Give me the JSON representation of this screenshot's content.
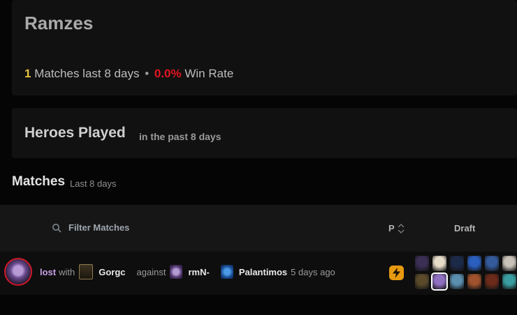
{
  "player": {
    "name": "Ramzes",
    "match_count": "1",
    "matches_label": "Matches last 8 days",
    "separator": "•",
    "winrate": "0.0%",
    "winrate_label": "Win Rate",
    "colors": {
      "count": "#e6c23a",
      "winrate": "#e3141f"
    }
  },
  "heroes_played": {
    "title": "Heroes Played",
    "subtitle": "in the past 8 days"
  },
  "matches": {
    "title": "Matches",
    "subtitle": "Last 8 days",
    "filter_placeholder": "Filter Matches",
    "columns": {
      "party": "P",
      "draft": "Draft"
    },
    "rows": [
      {
        "result": "lost",
        "with_word": "with",
        "ally": "Gorgc",
        "against_word": "against",
        "opponents": [
          "rmN-",
          "Palantimos"
        ],
        "time": "5 days ago",
        "party_icon": "lightning-icon",
        "hero_icon": "hero-portrait-icon",
        "draft": {
          "top": [
            "#3b2f55",
            "#e6dcc8",
            "#1c2a4a",
            "#2a5fbf",
            "#345a9c",
            "#c9c2b8"
          ],
          "bottom": [
            "#5a4a2a",
            "#8f6fbf",
            "#5a8fb0",
            "#a0522d",
            "#6b2a1a",
            "#3a9ea0"
          ]
        }
      }
    ]
  }
}
